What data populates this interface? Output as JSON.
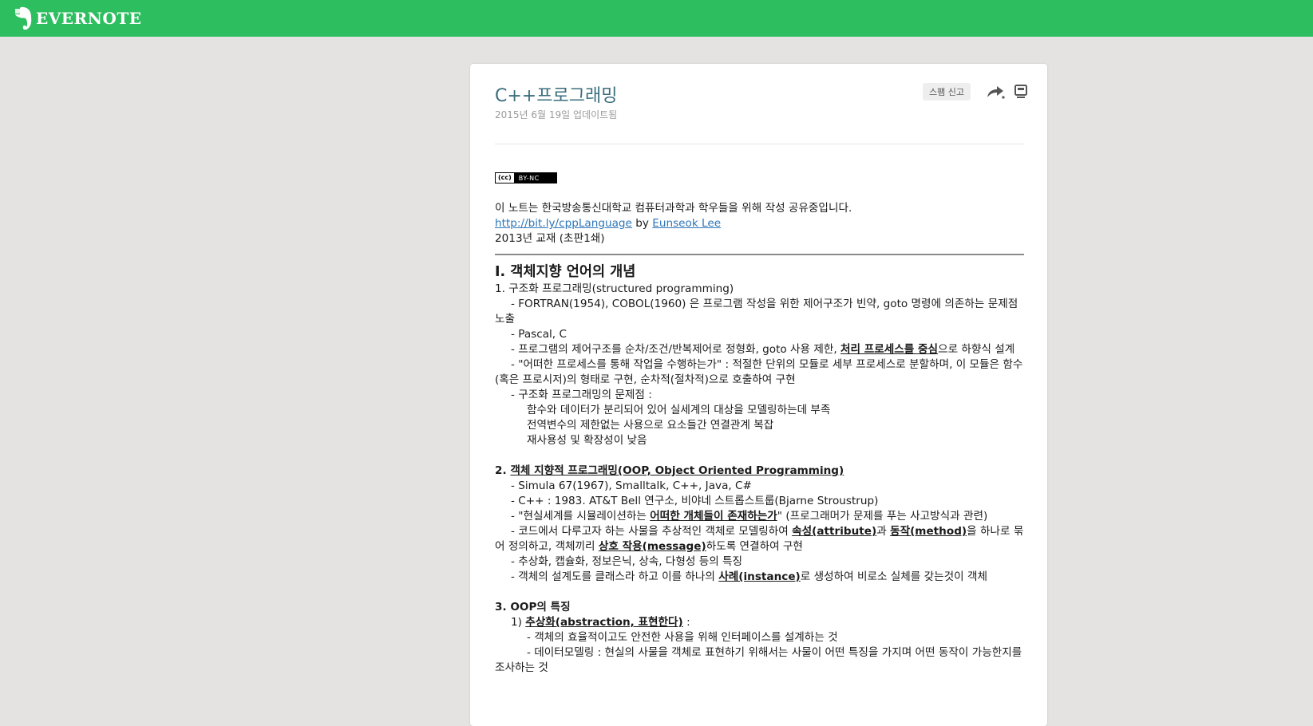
{
  "brand": {
    "name": "EVERNOTE",
    "color": "#2dbe60"
  },
  "note": {
    "title": "C++프로그래밍",
    "updated": "2015년 6월 19일 업데이트됨",
    "actions": {
      "spam_label": "스팸 신고",
      "share_icon": "share-icon",
      "present_icon": "presentation-icon"
    },
    "license": {
      "cc": "(cc)",
      "terms": "BY-NC"
    },
    "intro": "이 노트는 한국방송통신대학교 컴퓨터과학과 학우들을 위해 작성 공유중입니다.",
    "link": "http://bit.ly/cppLanguage",
    "by": " by ",
    "author": "Eunseok Lee",
    "edition": "2013년 교재 (초판1쇄)",
    "section1": {
      "heading": "I. 객체지향 언어의 개념",
      "sub1": "1. 구조화 프로그래밍(structured programming)",
      "l1": "- FORTRAN(1954), COBOL(1960) 은 프로그램 작성을 위한 제어구조가 빈약, goto 명령에 의존하는 문제점 노출",
      "l2": "- Pascal, C",
      "l3a": "- 프로그램의 제어구조를 순차/조건/반복제어로 정형화, goto 사용 제한, ",
      "l3b": "처리 프로세스를 중심",
      "l3c": "으로 하향식 설계",
      "l4": "- \"어떠한 프로세스를 통해 작업을 수행하는가\" : 적절한 단위의 모듈로 세부 프로세스로 분할하며, 이 모듈은 함수(혹은 프로시저)의 형태로 구현, 순차적(절차적)으로 호출하여 구현",
      "l5": "- 구조화 프로그래밍의 문제점 :",
      "p1": "함수와 데이터가 분리되어 있어 실세계의 대상을 모델링하는데 부족",
      "p2": "전역변수의 제한없는 사용으로 요소들간 연결관계 복잡",
      "p3": "재사용성 및 확장성이 낮음",
      "sub2num": "2. ",
      "sub2": "객체 지향적 프로그래밍(OOP, Object Oriented Programming)",
      "m1": "- Simula 67(1967), Smalltalk, C++, Java, C#",
      "m2": "- C++ : 1983. AT&T Bell 연구소, 비야네 스트롭스트룹(Bjarne Stroustrup)",
      "m3a": "- \"현실세계를 시뮬레이션하는 ",
      "m3b": "어떠한 개체들이 존재하는가",
      "m3c": "\" (프로그래머가 문제를 푸는 사고방식과 관련)",
      "m4a": "- 코드에서 다루고자 하는 사물을 추상적인 객체로 모델링하여 ",
      "m4b": "속성(attribute)",
      "m4c": "과 ",
      "m4d": "동작(method)",
      "m4e": "을 하나로 묶어 정의하고, 객체끼리 ",
      "m4f": "상호 작용(message)",
      "m4g": "하도록 연결하여 구현",
      "m5": "- 추상화, 캡슐화, 정보은닉, 상속, 다형성 등의 특징",
      "m6a": "- 객체의 설계도를 클래스라 하고 이를 하나의 ",
      "m6b": "사례(instance)",
      "m6c": "로 생성하여 비로소 실체를 갖는것이 객체",
      "sub3": "3. OOP의 특징",
      "f1num": "1) ",
      "f1": "추상화(abstraction, 표현한다)",
      "f1tail": " :",
      "f1a": "- 객체의 효율적이고도 안전한 사용을 위해 인터페이스를 설계하는 것",
      "f1b": "- 데이터모델링 : 현실의 사물을 객체로 표현하기 위해서는 사물이 어떤 특징을 가지며 어떤 동작이 가능한지를 조사하는 것"
    }
  }
}
